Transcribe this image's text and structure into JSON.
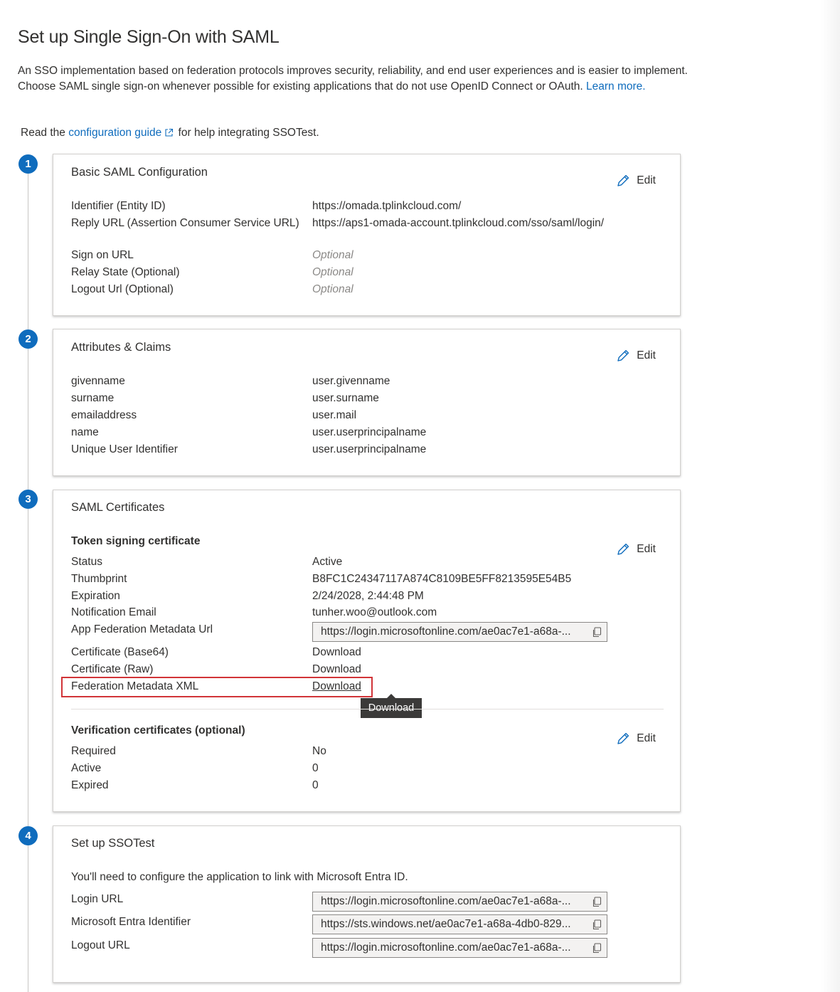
{
  "page": {
    "title": "Set up Single Sign-On with SAML",
    "intro": "An SSO implementation based on federation protocols improves security, reliability, and end user experiences and is easier to implement. Choose SAML single sign-on whenever possible for existing applications that do not use OpenID Connect or OAuth.",
    "learn_more": "Learn more.",
    "read_prefix": "Read the",
    "config_guide_link": "configuration guide",
    "read_suffix": "for help integrating SSOTest."
  },
  "steps": [
    "1",
    "2",
    "3",
    "4"
  ],
  "edit_label": "Edit",
  "basic": {
    "title": "Basic SAML Configuration",
    "rows": [
      {
        "label": "Identifier (Entity ID)",
        "value": "https://omada.tplinkcloud.com/"
      },
      {
        "label": "Reply URL (Assertion Consumer Service URL)",
        "value": "https://aps1-omada-account.tplinkcloud.com/sso/saml/login/"
      },
      {
        "label": "Sign on URL",
        "value": "Optional"
      },
      {
        "label": "Relay State (Optional)",
        "value": "Optional"
      },
      {
        "label": "Logout Url (Optional)",
        "value": "Optional"
      }
    ]
  },
  "attributes": {
    "title": "Attributes & Claims",
    "rows": [
      {
        "label": "givenname",
        "value": "user.givenname"
      },
      {
        "label": "surname",
        "value": "user.surname"
      },
      {
        "label": "emailaddress",
        "value": "user.mail"
      },
      {
        "label": "name",
        "value": "user.userprincipalname"
      },
      {
        "label": "Unique User Identifier",
        "value": "user.userprincipalname"
      }
    ]
  },
  "certificates": {
    "title": "SAML Certificates",
    "token_title": "Token signing certificate",
    "rows": [
      {
        "label": "Status",
        "value": "Active"
      },
      {
        "label": "Thumbprint",
        "value": "B8FC1C24347117A874C8109BE5FF8213595E54B5"
      },
      {
        "label": "Expiration",
        "value": "2/24/2028, 2:44:48 PM"
      },
      {
        "label": "Notification Email",
        "value": "tunher.woo@outlook.com"
      },
      {
        "label": "App Federation Metadata Url",
        "value": "https://login.microsoftonline.com/ae0ac7e1-a68a-..."
      }
    ],
    "downloads": [
      {
        "label": "Certificate (Base64)",
        "link": "Download"
      },
      {
        "label": "Certificate (Raw)",
        "link": "Download"
      },
      {
        "label": "Federation Metadata XML",
        "link": "Download"
      }
    ],
    "tooltip": "Download",
    "verification_title": "Verification certificates (optional)",
    "verification_rows": [
      {
        "label": "Required",
        "value": "No"
      },
      {
        "label": "Active",
        "value": "0"
      },
      {
        "label": "Expired",
        "value": "0"
      }
    ]
  },
  "setup": {
    "title": "Set up SSOTest",
    "note": "You'll need to configure the application to link with Microsoft Entra ID.",
    "rows": [
      {
        "label": "Login URL",
        "value": "https://login.microsoftonline.com/ae0ac7e1-a68a-..."
      },
      {
        "label": "Microsoft Entra Identifier",
        "value": "https://sts.windows.net/ae0ac7e1-a68a-4db0-829..."
      },
      {
        "label": "Logout URL",
        "value": "https://login.microsoftonline.com/ae0ac7e1-a68a-..."
      }
    ]
  },
  "colors": {
    "accent": "#0f6cbd",
    "highlight": "#d13438",
    "tooltip_bg": "#3b3a39"
  },
  "icons": [
    "external-link-icon",
    "pencil-edit-icon",
    "copy-icon"
  ]
}
